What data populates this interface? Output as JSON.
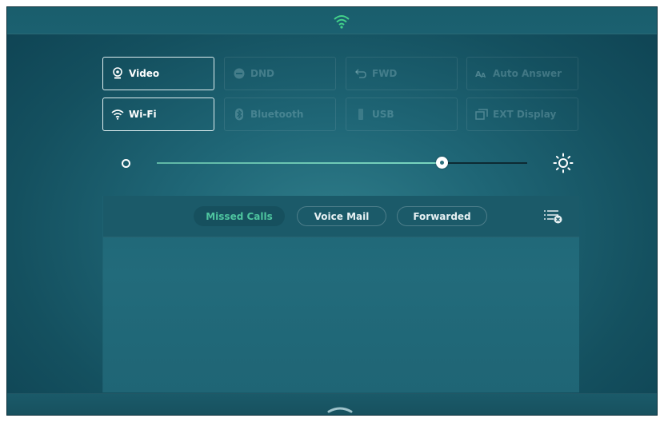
{
  "status_bar": {
    "network_icon": "wifi-icon"
  },
  "tiles": [
    {
      "id": "video",
      "label": "Video",
      "icon": "webcam-icon",
      "state": "active"
    },
    {
      "id": "dnd",
      "label": "DND",
      "icon": "do-not-disturb-icon",
      "state": "inactive"
    },
    {
      "id": "fwd",
      "label": "FWD",
      "icon": "forward-arrow-icon",
      "state": "inactive"
    },
    {
      "id": "auto-answer",
      "label": "Auto Answer",
      "icon": "auto-answer-icon",
      "state": "inactive"
    },
    {
      "id": "wifi",
      "label": "Wi-Fi",
      "icon": "wifi-icon",
      "state": "active"
    },
    {
      "id": "bluetooth",
      "label": "Bluetooth",
      "icon": "bluetooth-icon",
      "state": "inactive"
    },
    {
      "id": "usb",
      "label": "USB",
      "icon": "usb-icon",
      "state": "inactive"
    },
    {
      "id": "ext-display",
      "label": "EXT Display",
      "icon": "external-display-icon",
      "state": "inactive"
    }
  ],
  "brightness": {
    "level": 0.78,
    "low_icon": "brightness-low-icon",
    "high_icon": "brightness-high-icon"
  },
  "calls_panel": {
    "tabs": [
      {
        "label": "Missed Calls",
        "selected": true
      },
      {
        "label": "Voice Mail",
        "selected": false
      },
      {
        "label": "Forwarded",
        "selected": false
      }
    ],
    "clear_icon": "clear-list-icon"
  },
  "bottom_bar": {
    "handle_icon": "chevron-up-icon"
  },
  "colors": {
    "background": "#1f6676",
    "accent": "#4ec59f",
    "text": "#ffffff"
  }
}
